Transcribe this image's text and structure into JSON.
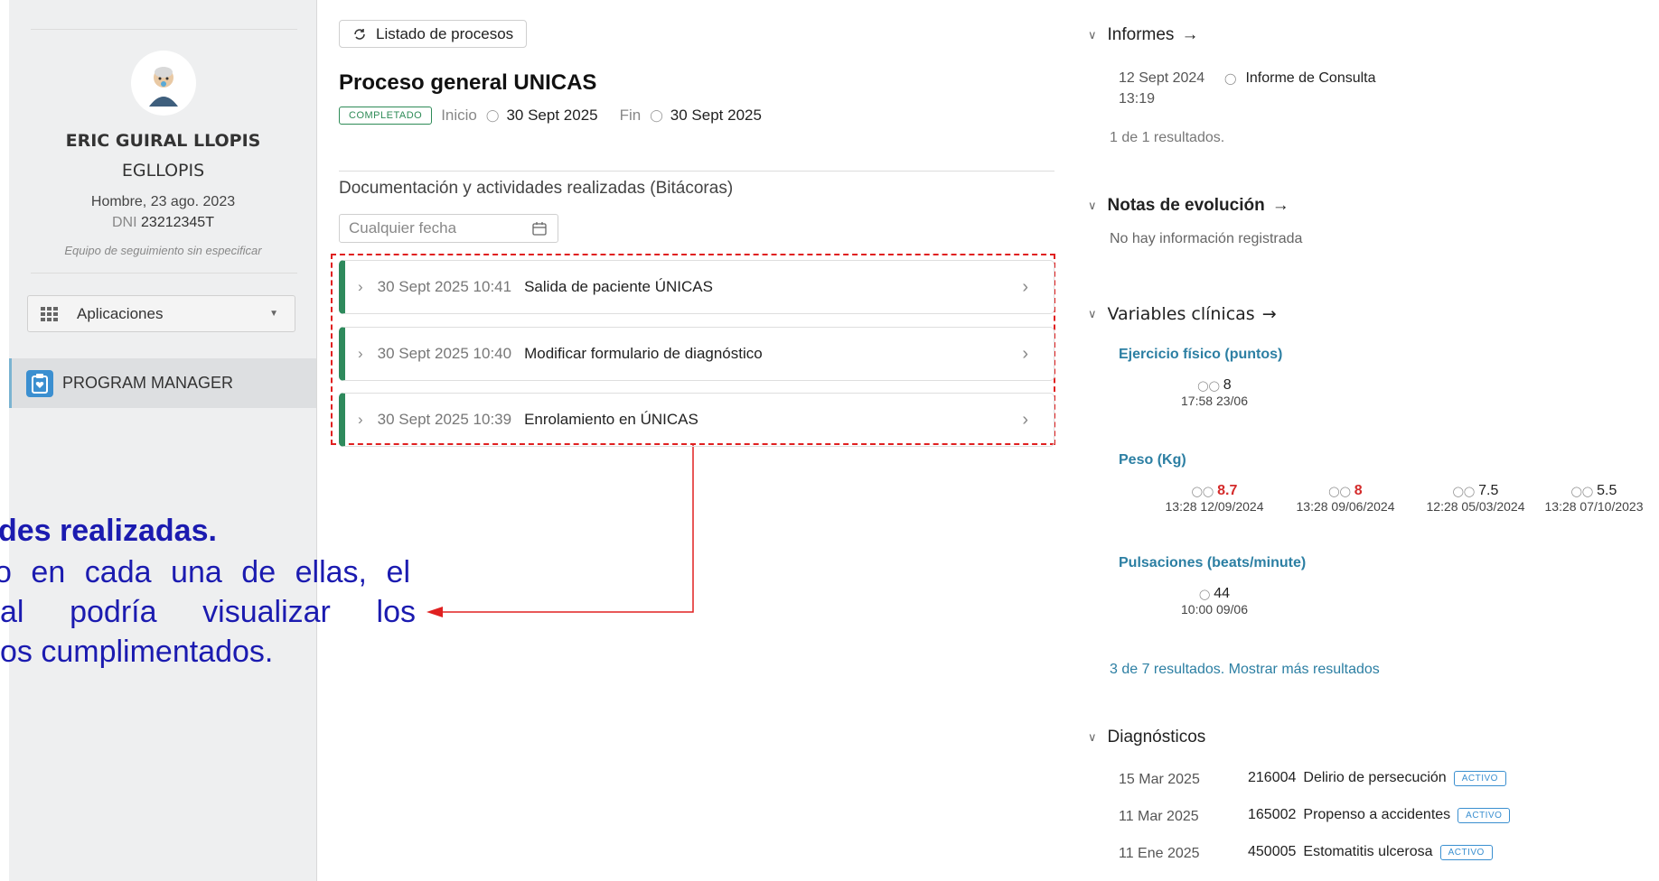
{
  "sidebar": {
    "patient_name": "ERIC GUIRAL LLOPIS",
    "username": "EGLLOPIS",
    "gender_dob": "Hombre, 23 ago. 2023",
    "dni_label": "DNI",
    "dni_value": "23212345T",
    "team": "Equipo de seguimiento sin especificar",
    "apps_label": "Aplicaciones",
    "program_label": "PROGRAM MANAGER"
  },
  "annotation": {
    "line1": "des realizadas.",
    "line2": "o en cada una de ellas, el",
    "line3": "al podría visualizar los",
    "line4": "os cumplimentados."
  },
  "main": {
    "list_button": "Listado de procesos",
    "title": "Proceso general UNICAS",
    "status_badge": "COMPLETADO",
    "start_label": "Inicio",
    "start_date": "30 Sept 2025",
    "end_label": "Fin",
    "end_date": "30 Sept 2025",
    "docs_title": "Documentación y actividades realizadas (Bitácoras)",
    "date_placeholder": "Cualquier fecha",
    "logs": [
      {
        "date": "30 Sept 2025 10:41",
        "text": "Salida de paciente ÚNICAS"
      },
      {
        "date": "30 Sept 2025 10:40",
        "text": "Modificar formulario de diagnóstico"
      },
      {
        "date": "30 Sept 2025 10:39",
        "text": "Enrolamiento en ÚNICAS"
      }
    ]
  },
  "right": {
    "informes": {
      "title": "Informes",
      "date": "12 Sept 2024",
      "time": "13:19",
      "type": "Informe de Consulta",
      "results": "1 de 1 resultados."
    },
    "notas": {
      "title": "Notas de evolución",
      "empty": "No hay información registrada"
    },
    "variables": {
      "title": "Variables clínicas",
      "ejercicio": {
        "title": "Ejercicio físico (puntos)",
        "value": "8",
        "when": "17:58 23/06"
      },
      "peso": {
        "title": "Peso (Kg)",
        "items": [
          {
            "value": "8.7",
            "when": "13:28 12/09/2024"
          },
          {
            "value": "8",
            "when": "13:28 09/06/2024"
          },
          {
            "value": "7.5",
            "when": "12:28 05/03/2024"
          },
          {
            "value": "5.5",
            "when": "13:28 07/10/2023"
          }
        ]
      },
      "pulsaciones": {
        "title": "Pulsaciones (beats/minute)",
        "value": "44",
        "when": "10:00 09/06"
      },
      "results": "3 de 7 resultados. Mostrar más resultados"
    },
    "diagnosticos": {
      "title": "Diagnósticos",
      "badge": "ACTIVO",
      "items": [
        {
          "date": "15 Mar 2025",
          "code": "216004",
          "name": "Delirio de persecución"
        },
        {
          "date": "11 Mar 2025",
          "code": "165002",
          "name": "Propenso a accidentes"
        },
        {
          "date": "11 Ene 2025",
          "code": "450005",
          "name": "Estomatitis ulcerosa"
        }
      ]
    }
  },
  "colors": {
    "accent_green": "#2e8a5c",
    "annotation_blue": "#1b1bb0",
    "highlight_red": "#e02020",
    "link_teal": "#2c7fa3"
  }
}
